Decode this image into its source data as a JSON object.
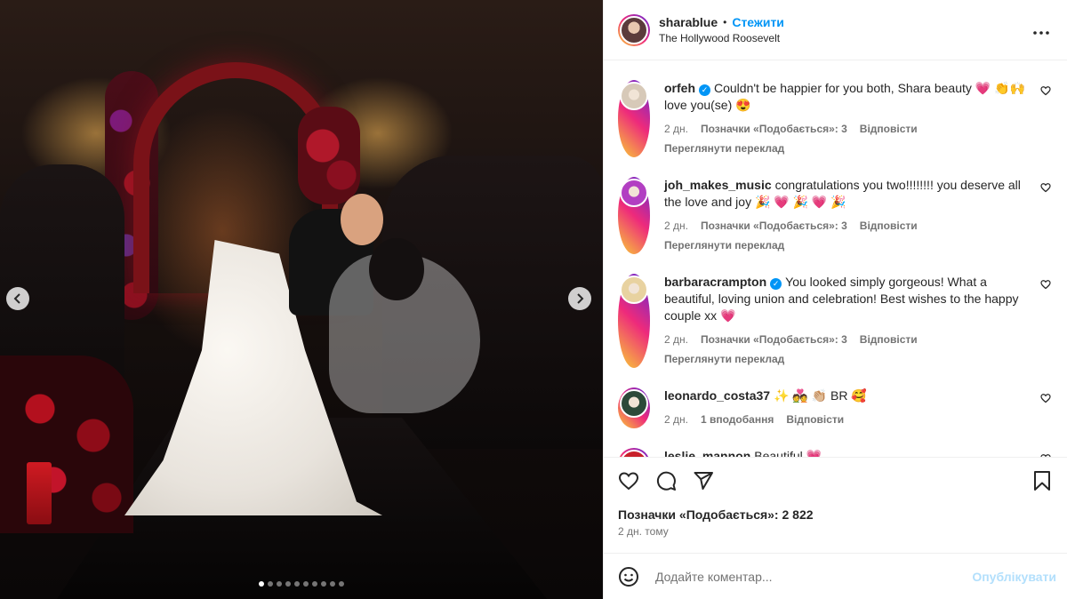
{
  "post": {
    "username": "sharablue",
    "separator": "•",
    "follow_label": "Стежити",
    "location": "The Hollywood Roosevelt",
    "more_label": "···",
    "carousel": {
      "slides": 10,
      "active_index": 0
    }
  },
  "comments": [
    {
      "user": "orfeh",
      "verified": true,
      "text": "Couldn't be happier for you both, Shara beauty 💗 👏🙌 love you(se) 😍",
      "time": "2 дн.",
      "likes": "Позначки «Подобається»: 3",
      "reply": "Відповісти",
      "translate": "Переглянути переклад",
      "avatar_color": "#d7c9b8"
    },
    {
      "user": "joh_makes_music",
      "verified": false,
      "text": "congratulations you two!!!!!!!! you deserve all the love and joy 🎉 💗 🎉 💗 🎉",
      "time": "2 дн.",
      "likes": "Позначки «Подобається»: 3",
      "reply": "Відповісти",
      "translate": "Переглянути переклад",
      "avatar_color": "#b23fc2"
    },
    {
      "user": "barbaracrampton",
      "verified": true,
      "text": "You looked simply gorgeous! What a beautiful, loving union and celebration! Best wishes to the happy couple xx 💗",
      "time": "2 дн.",
      "likes": "Позначки «Подобається»: 3",
      "reply": "Відповісти",
      "translate": "Переглянути переклад",
      "avatar_color": "#e8d2a0"
    },
    {
      "user": "leonardo_costa37",
      "verified": false,
      "text": "✨ 💑 👏🏼 BR 🥰",
      "time": "2 дн.",
      "likes": "1 вподобання",
      "reply": "Відповісти",
      "translate": "",
      "avatar_color": "#2d4a3a"
    },
    {
      "user": "leslie_mannon",
      "verified": false,
      "text": "Beautiful 💗",
      "time": "",
      "likes": "",
      "reply": "",
      "translate": "",
      "avatar_color": "#c8202a"
    }
  ],
  "actions": {
    "like_icon": "heart-icon",
    "comment_icon": "comment-icon",
    "share_icon": "share-icon",
    "save_icon": "bookmark-icon",
    "likes_text": "Позначки «Подобається»: 2 822",
    "date_text": "2 дн. тому"
  },
  "composer": {
    "placeholder": "Додайте коментар...",
    "value": "",
    "publish_label": "Опублікувати",
    "emoji_icon": "emoji-icon"
  },
  "colors": {
    "accent": "#0095f6",
    "publish_disabled": "#b2dffc",
    "secondary_text": "#737373"
  }
}
